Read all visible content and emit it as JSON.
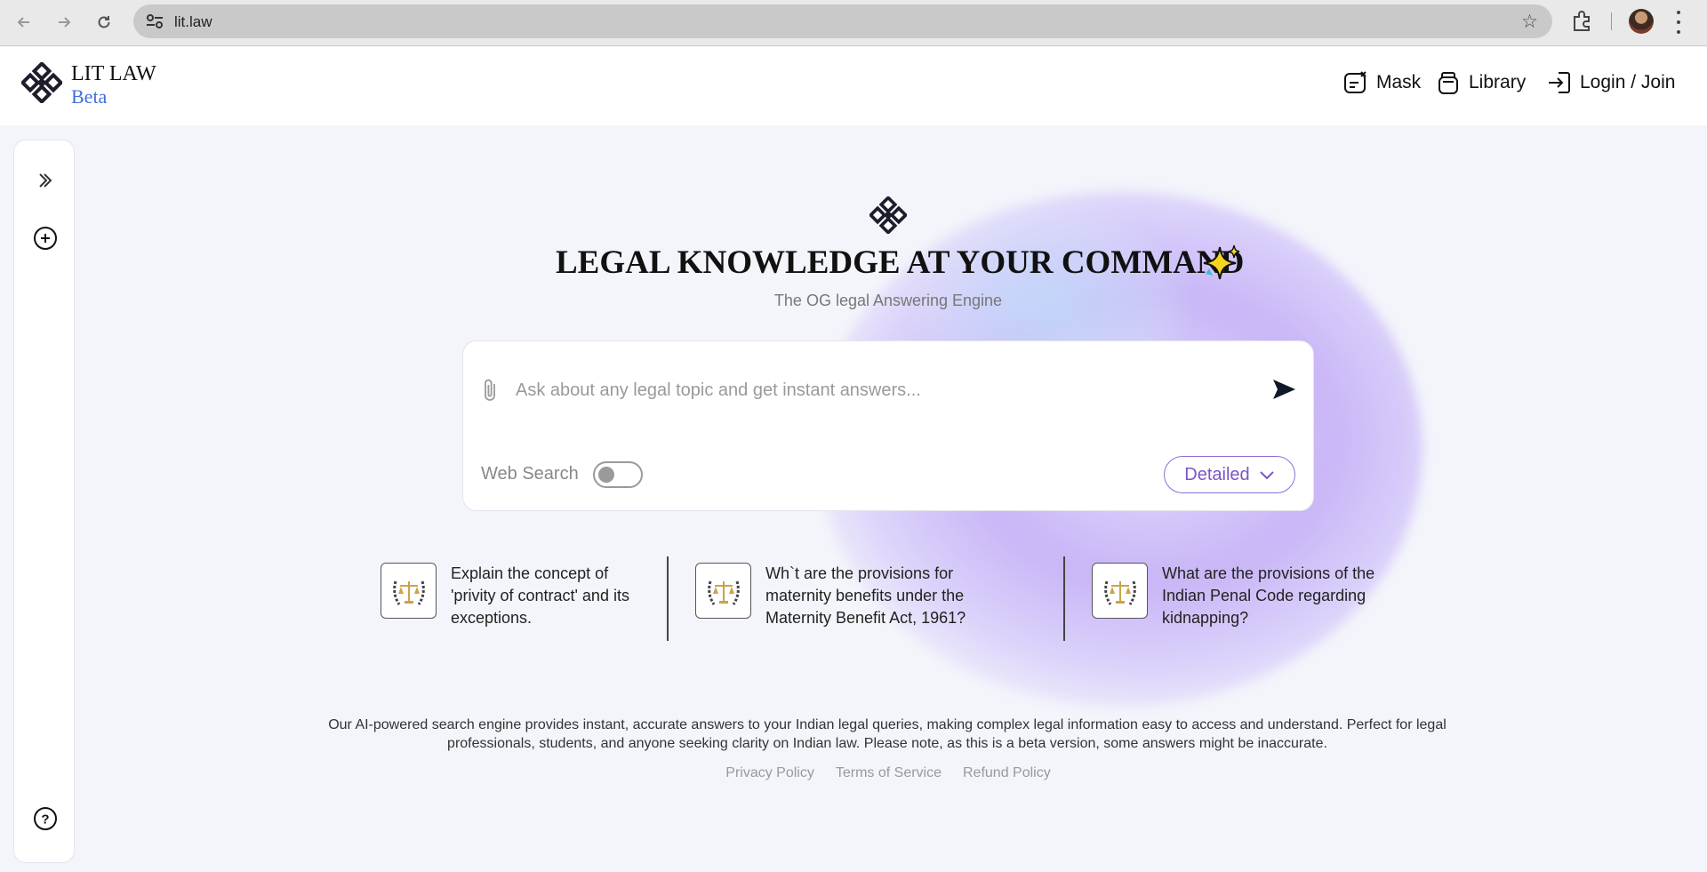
{
  "browser": {
    "url": "lit.law",
    "icons": [
      "back-arrow-icon",
      "forward-arrow-icon",
      "reload-icon",
      "site-settings-icon",
      "bookmark-star-icon",
      "extensions-icon",
      "profile-avatar",
      "menu-icon"
    ]
  },
  "header": {
    "brand_name": "LIT LAW",
    "brand_tag": "Beta",
    "nav": {
      "mask": "Mask",
      "library": "Library",
      "login": "Login / Join"
    }
  },
  "sidebar": {
    "icons": [
      "expand-chevron-icon",
      "new-chat-icon",
      "help-icon"
    ]
  },
  "hero": {
    "title": "LEGAL KNOWLEDGE AT YOUR COMMAND",
    "subtitle": "The OG legal Answering Engine"
  },
  "search": {
    "placeholder": "Ask about any legal topic and get instant answers...",
    "value": "",
    "web_search_label": "Web Search",
    "web_search_enabled": false,
    "mode": "Detailed"
  },
  "suggestions": [
    {
      "text": "Explain the concept of 'privity of contract' and its exceptions."
    },
    {
      "text": "Wh`t are the provisions for maternity benefits under the Maternity Benefit Act, 1961?"
    },
    {
      "text": "What are the provisions of the Indian Penal Code regarding kidnapping?"
    }
  ],
  "disclaimer": "Our AI-powered search engine provides instant, accurate answers to your Indian legal queries, making complex legal information easy to access and understand. Perfect for legal professionals, students, and anyone seeking clarity on Indian law. Please note, as this is a beta version, some answers might be inaccurate.",
  "footer": {
    "privacy": "Privacy Policy",
    "terms": "Terms of Service",
    "refund": "Refund Policy"
  },
  "colors": {
    "accent_purple": "#7a55c9",
    "beta_blue": "#3f6fd8",
    "page_bg": "#f3f5fb"
  }
}
